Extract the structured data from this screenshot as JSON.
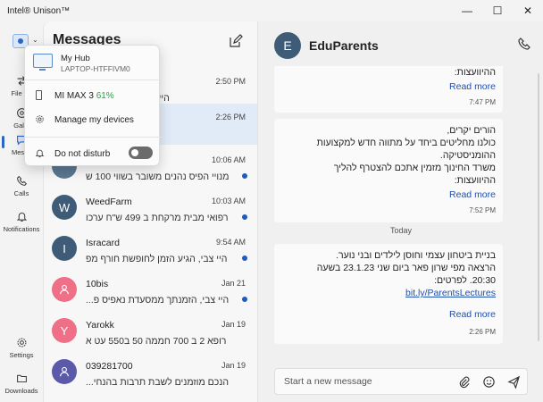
{
  "window": {
    "title": "Intel® Unison™",
    "minimize": "—",
    "maximize": "☐",
    "close": "✕"
  },
  "rail": {
    "items": [
      {
        "label": "File tra",
        "icon": "file-transfer-icon"
      },
      {
        "label": "Galle",
        "icon": "gallery-icon"
      },
      {
        "label": "Messa",
        "icon": "messages-icon"
      },
      {
        "label": "Calls",
        "icon": "phone-icon"
      },
      {
        "label": "Notifications",
        "icon": "bell-icon"
      },
      {
        "label": "Settings",
        "icon": "gear-icon"
      },
      {
        "label": "Downloads",
        "icon": "folder-icon"
      }
    ]
  },
  "messages": {
    "title": "Messages",
    "conversations": [
      {
        "name": "",
        "initial": "",
        "time": "2:50 PM",
        "preview": "היי צבי, עוד לא בדקת",
        "color": "#5b7690",
        "unread": false,
        "selected": false
      },
      {
        "name": "",
        "initial": "",
        "time": "2:26 PM",
        "preview": "בניית ביטחון עצמי",
        "color": "#5b7690",
        "unread": false,
        "selected": true
      },
      {
        "name": "",
        "initial": "",
        "time": "10:06 AM",
        "preview": "מנויי הפיס נהנים משובר בשווי 100 ש",
        "color": "#5b7690",
        "unread": true,
        "selected": false
      },
      {
        "name": "WeedFarm",
        "initial": "W",
        "time": "10:03 AM",
        "preview": "רפואי מבית מרקחת ב 499 ש\"ח ערכו",
        "color": "#3e5c77",
        "unread": true,
        "selected": false
      },
      {
        "name": "Isracard",
        "initial": "I",
        "time": "9:54 AM",
        "preview": "היי צבי, הגיע הזמן לחופשת חורף מפ",
        "color": "#3e5c77",
        "unread": true,
        "selected": false
      },
      {
        "name": "10bis",
        "initial": "person",
        "time": "Jan 21",
        "preview": "היי צבי, הזמנתך ממסעדת נאפיס פ...",
        "color": "#ef6f87",
        "unread": true,
        "selected": false
      },
      {
        "name": "Yarokk",
        "initial": "Y",
        "time": "Jan 19",
        "preview": "רופא 2 ב 700 חממה 50 ב550 עט א",
        "color": "#ef6f87",
        "unread": false,
        "selected": false
      },
      {
        "name": "039281700",
        "initial": "person",
        "time": "Jan 19",
        "preview": "הנכם מוזמנים לשבת תרבות בהנחי...",
        "color": "#5a5aa8",
        "unread": false,
        "selected": false
      }
    ]
  },
  "chat": {
    "name": "EduParents",
    "initial": "E",
    "bubble1": {
      "lines": [
        "ההיוועצות:"
      ],
      "more": "Read more",
      "time": "7:47 PM"
    },
    "bubble2": {
      "lines": [
        "הורים יקרים,",
        "כולנו מחליטים ביחד על מתווה חדש למקצועות",
        "ההומניסטיקה.",
        "משרד החינוך מזמין אתכם להצטרף להליך",
        "ההיוועצות:"
      ],
      "more": "Read more",
      "time": "7:52 PM"
    },
    "day": "Today",
    "bubble3": {
      "lines": [
        "בניית ביטחון עצמי וחוסן לילדים ובני נוער.",
        "הרצאה מפי שרון פאר ביום שני 23.1.23 בשעה",
        "20:30. לפרטים:"
      ],
      "link": "bit.ly/ParentsLectures",
      "more": "Read more",
      "time": "2:26 PM"
    },
    "composer": {
      "placeholder": "Start a new message"
    }
  },
  "hub_popup": {
    "hub_name": "My Hub",
    "laptop": "LAPTOP-HTFFIVM0",
    "device": "MI MAX 3",
    "battery": "61%",
    "manage": "Manage my devices",
    "dnd": "Do not disturb",
    "dnd_on": false
  },
  "colors": {
    "accent": "#2b66c7",
    "link": "#1f4fae",
    "battery": "#2e9e4a"
  }
}
